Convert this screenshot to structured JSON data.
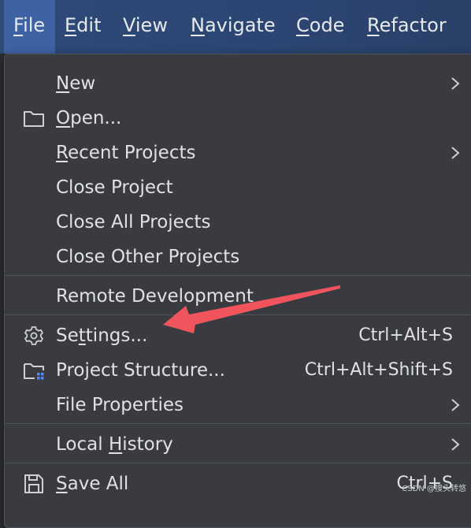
{
  "menubar": {
    "items": [
      {
        "label": "File",
        "u": "F",
        "rest": "ile",
        "active": true
      },
      {
        "label": "Edit",
        "u": "E",
        "rest": "dit"
      },
      {
        "label": "View",
        "u": "V",
        "rest": "iew"
      },
      {
        "label": "Navigate",
        "u": "N",
        "rest": "avigate"
      },
      {
        "label": "Code",
        "u": "C",
        "rest": "ode"
      },
      {
        "label": "Refactor",
        "u": "R",
        "rest": "efactor"
      }
    ]
  },
  "file_menu": {
    "new": {
      "pre": "",
      "u": "N",
      "post": "ew"
    },
    "open": {
      "pre": "",
      "u": "O",
      "post": "pen..."
    },
    "recent_projects": {
      "pre": "",
      "u": "R",
      "post": "ecent Projects"
    },
    "close_project": {
      "label": "Close Project"
    },
    "close_all_projects": {
      "label": "Close All Projects"
    },
    "close_other_projects": {
      "label": "Close Other Projects"
    },
    "remote_development": {
      "label": "Remote Development"
    },
    "settings": {
      "pre": "Se",
      "u": "t",
      "post": "tings...",
      "shortcut": "Ctrl+Alt+S"
    },
    "project_structure": {
      "label": "Project Structure...",
      "shortcut": "Ctrl+Alt+Shift+S"
    },
    "file_properties": {
      "label": "File Properties"
    },
    "local_history": {
      "pre": "Local ",
      "u": "H",
      "post": "istory"
    },
    "save_all": {
      "pre": "",
      "u": "S",
      "post": "ave All",
      "shortcut": "Ctrl+S"
    }
  },
  "annotation": {
    "color": "#f0545c"
  },
  "watermark": {
    "text": "CSDN @搜头转悠"
  }
}
